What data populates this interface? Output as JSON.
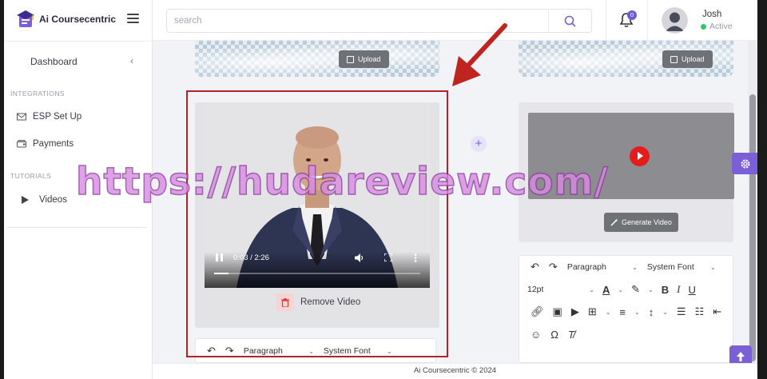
{
  "brand": {
    "name": "Ai Coursecentric"
  },
  "sidebar": {
    "dashboard_label": "Dashboard",
    "sections": [
      {
        "label": "INTEGRATIONS",
        "items": [
          {
            "label": "ESP Set Up"
          },
          {
            "label": "Payments"
          }
        ]
      },
      {
        "label": "TUTORIALS",
        "items": [
          {
            "label": "Videos"
          }
        ]
      }
    ]
  },
  "header": {
    "search_placeholder": "search",
    "notifications_count": "0",
    "user": {
      "name": "Josh",
      "status": "Active"
    }
  },
  "main": {
    "upload_label": "Upload",
    "video": {
      "time": "0:03 / 2:26",
      "progress": 0.07
    },
    "remove_video_label": "Remove Video",
    "plus_label": "+",
    "generate_video_label": "Generate Video",
    "editor": {
      "block_format": "Paragraph",
      "font_family": "System Font",
      "font_size": "12pt"
    }
  },
  "footer": {
    "text": "Ai Coursecentric © 2024"
  },
  "watermark": {
    "text": "https://hudareview.com/"
  },
  "colors": {
    "accent": "#7b5fd6",
    "highlight": "#b52424",
    "status_active": "#35c36b",
    "danger": "#e51c1c"
  }
}
